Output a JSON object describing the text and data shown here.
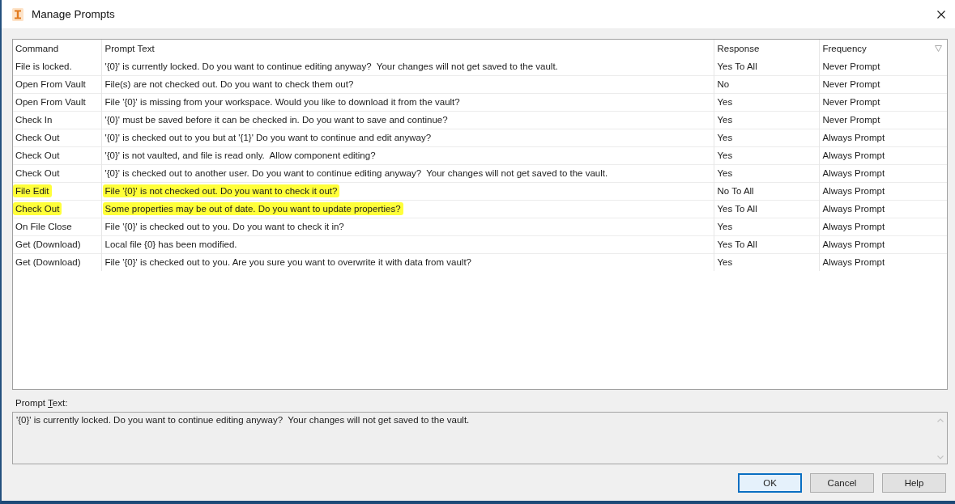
{
  "window": {
    "title": "Manage Prompts"
  },
  "table": {
    "columns": [
      {
        "label": "Command",
        "sort_indicator": false
      },
      {
        "label": "Prompt Text",
        "sort_indicator": false
      },
      {
        "label": "Response",
        "sort_indicator": false
      },
      {
        "label": "Frequency",
        "sort_indicator": true
      }
    ],
    "rows": [
      {
        "command": "File is locked.",
        "prompt_text": "'{0}' is currently locked. Do you want to continue editing anyway?  Your changes will not get saved to the vault.",
        "response": "Yes To All",
        "frequency": "Never Prompt",
        "highlighted": false
      },
      {
        "command": "Open From Vault",
        "prompt_text": "File(s) are not checked out. Do you want to check them out?",
        "response": "No",
        "frequency": "Never Prompt",
        "highlighted": false
      },
      {
        "command": "Open From Vault",
        "prompt_text": "File '{0}' is missing from your workspace. Would you like to download it from the vault?",
        "response": "Yes",
        "frequency": "Never Prompt",
        "highlighted": false
      },
      {
        "command": "Check In",
        "prompt_text": "'{0}' must be saved before it can be checked in. Do you want to save and continue?",
        "response": "Yes",
        "frequency": "Never Prompt",
        "highlighted": false
      },
      {
        "command": "Check Out",
        "prompt_text": "'{0}' is checked out to you but at '{1}' Do you want to continue and edit anyway?",
        "response": "Yes",
        "frequency": "Always Prompt",
        "highlighted": false
      },
      {
        "command": "Check Out",
        "prompt_text": "'{0}' is not vaulted, and file is read only.  Allow component editing?",
        "response": "Yes",
        "frequency": "Always Prompt",
        "highlighted": false
      },
      {
        "command": "Check Out",
        "prompt_text": "'{0}' is checked out to another user. Do you want to continue editing anyway?  Your changes will not get saved to the vault.",
        "response": "Yes",
        "frequency": "Always Prompt",
        "highlighted": false
      },
      {
        "command": "File Edit",
        "prompt_text": "File '{0}' is not checked out. Do you want to check it out?",
        "response": "No To All",
        "frequency": "Always Prompt",
        "highlighted": true
      },
      {
        "command": "Check Out",
        "prompt_text": "Some properties may be out of date. Do you want to update properties?",
        "response": "Yes To All",
        "frequency": "Always Prompt",
        "highlighted": true
      },
      {
        "command": "On File Close",
        "prompt_text": "File '{0}' is checked out to you. Do you want to check it in?",
        "response": "Yes",
        "frequency": "Always Prompt",
        "highlighted": false
      },
      {
        "command": "Get (Download)",
        "prompt_text": "Local file {0} has been modified.",
        "response": "Yes To All",
        "frequency": "Always Prompt",
        "highlighted": false
      },
      {
        "command": "Get (Download)",
        "prompt_text": "File '{0}' is checked out to you. Are you sure you want to overwrite it with data from vault?",
        "response": "Yes",
        "frequency": "Always Prompt",
        "highlighted": false
      }
    ]
  },
  "prompt_text": {
    "label_parts": [
      {
        "text": "Prompt ",
        "underlined": false
      },
      {
        "text": "T",
        "underlined": true
      },
      {
        "text": "ext:",
        "underlined": false
      }
    ],
    "value": "'{0}' is currently locked. Do you want to continue editing anyway?  Your changes will not get saved to the vault."
  },
  "buttons": [
    {
      "label": "OK",
      "default": true
    },
    {
      "label": "Cancel",
      "default": false
    },
    {
      "label": "Help",
      "default": false
    }
  ]
}
